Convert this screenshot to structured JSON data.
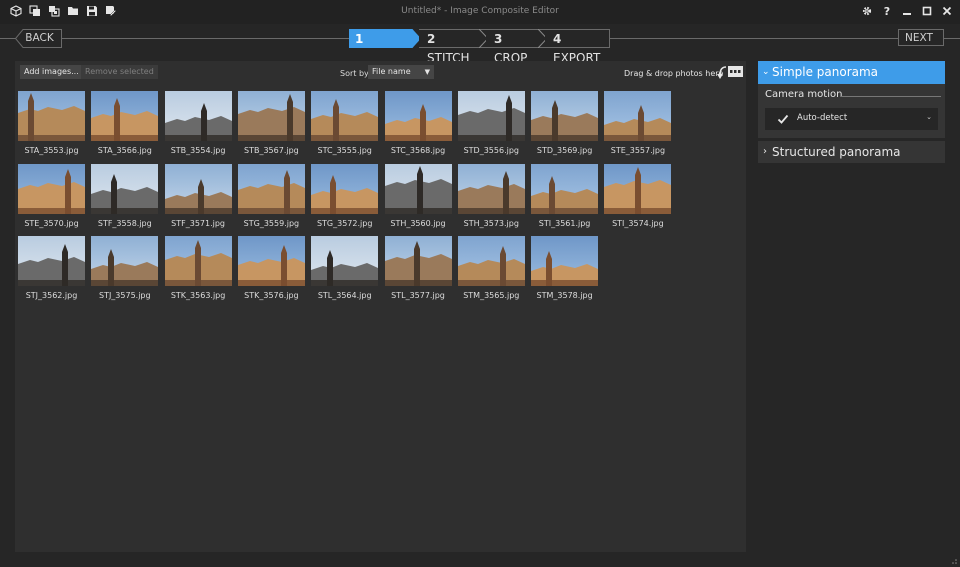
{
  "window": {
    "title": "Untitled* - Image Composite Editor",
    "toolbar_icons": [
      "new-panorama-icon",
      "new-video-panorama-icon",
      "open-image-icon",
      "open-folder-icon",
      "save-icon",
      "save-as-icon"
    ],
    "controls": [
      "settings-icon",
      "help-icon",
      "minimize-icon",
      "maximize-icon",
      "close-icon"
    ],
    "help_label": "?"
  },
  "nav": {
    "back_label": "BACK",
    "next_label": "NEXT",
    "steps": [
      {
        "num": "1",
        "label": "IMPORT",
        "active": true
      },
      {
        "num": "2",
        "label": "STITCH",
        "active": false
      },
      {
        "num": "3",
        "label": "CROP",
        "active": false
      },
      {
        "num": "4",
        "label": "EXPORT",
        "active": false
      }
    ]
  },
  "import": {
    "add_label": "Add images...",
    "remove_label": "Remove selected",
    "sort_label": "Sort by",
    "sort_value": "File name",
    "drag_label": "Drag & drop photos here"
  },
  "images": [
    "STA_3553.jpg",
    "STA_3566.jpg",
    "STB_3554.jpg",
    "STB_3567.jpg",
    "STC_3555.jpg",
    "STC_3568.jpg",
    "STD_3556.jpg",
    "STD_3569.jpg",
    "STE_3557.jpg",
    "STE_3570.jpg",
    "STF_3558.jpg",
    "STF_3571.jpg",
    "STG_3559.jpg",
    "STG_3572.jpg",
    "STH_3560.jpg",
    "STH_3573.jpg",
    "STI_3561.jpg",
    "STI_3574.jpg",
    "STJ_3562.jpg",
    "STJ_3575.jpg",
    "STK_3563.jpg",
    "STK_3576.jpg",
    "STL_3564.jpg",
    "STL_3577.jpg",
    "STM_3565.jpg",
    "STM_3578.jpg"
  ],
  "panel": {
    "simple_label": "Simple panorama",
    "camera_motion_label": "Camera motion",
    "camera_motion_value": "Auto-detect",
    "structured_label": "Structured panorama"
  },
  "colors": {
    "accent": "#3e9ce9",
    "background": "#262626",
    "panel": "#2f2f2f"
  }
}
